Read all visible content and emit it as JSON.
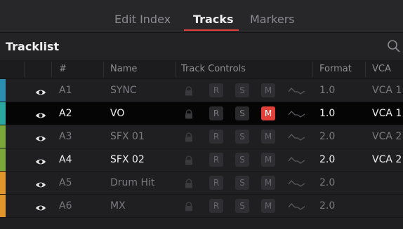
{
  "tabs": [
    {
      "label": "Edit Index",
      "active": false
    },
    {
      "label": "Tracks",
      "active": true
    },
    {
      "label": "Markers",
      "active": false
    }
  ],
  "panel": {
    "title": "Tracklist"
  },
  "columns": {
    "number": "#",
    "name": "Name",
    "track_controls": "Track Controls",
    "format": "Format",
    "vca": "VCA"
  },
  "tracks": [
    {
      "id": "A1",
      "name": "SYNC",
      "format": "1.0",
      "vca": "VCA 1",
      "color": "#2a8fb0",
      "muted": false,
      "selected": false,
      "active": false
    },
    {
      "id": "A2",
      "name": "VO",
      "format": "1.0",
      "vca": "VCA 1",
      "color": "#2aa8a0",
      "muted": true,
      "selected": true,
      "active": true
    },
    {
      "id": "A3",
      "name": "SFX 01",
      "format": "2.0",
      "vca": "VCA 2",
      "color": "#7aa83a",
      "muted": false,
      "selected": false,
      "active": false
    },
    {
      "id": "A4",
      "name": "SFX 02",
      "format": "2.0",
      "vca": "VCA 2",
      "color": "#7aa83a",
      "muted": false,
      "selected": false,
      "active": true
    },
    {
      "id": "A5",
      "name": "Drum Hit",
      "format": "2.0",
      "vca": "",
      "color": "#e0962a",
      "muted": false,
      "selected": false,
      "active": false
    },
    {
      "id": "A6",
      "name": "MX",
      "format": "2.0",
      "vca": "",
      "color": "#e0962a",
      "muted": false,
      "selected": false,
      "active": false
    }
  ],
  "controls": {
    "record": "R",
    "solo": "S",
    "mute": "M"
  },
  "icons": {
    "search": "search-icon",
    "visibility": "eye-icon",
    "lock": "lock-icon",
    "waveform": "waveform-icon"
  },
  "colors": {
    "accent": "#e0413a"
  }
}
